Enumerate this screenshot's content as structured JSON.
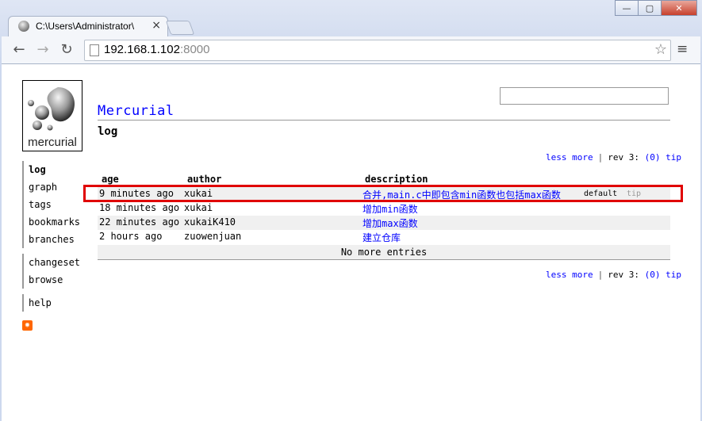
{
  "browser": {
    "tab_title": "C:\\Users\\Administrator\\",
    "tab_close": "×",
    "url_host": "192.168.1.102",
    "url_port": ":8000",
    "back": "←",
    "forward": "→",
    "reload": "↻",
    "star": "☆",
    "menu": "≡",
    "minimize": "—",
    "maximize": "▢",
    "close": "✕"
  },
  "header": {
    "logo_text": "mercurial",
    "title": "Mercurial",
    "subtitle": "log"
  },
  "sidebar": {
    "group1": [
      "log",
      "graph",
      "tags",
      "bookmarks",
      "branches"
    ],
    "group2": [
      "changeset",
      "browse"
    ],
    "group3": [
      "help"
    ],
    "rss": "rss"
  },
  "navigation": {
    "less": "less",
    "more": "more",
    "sep": "|",
    "rev": "rev 3:",
    "zero": "(0)",
    "tip": "tip"
  },
  "table": {
    "columns": [
      "age",
      "author",
      "description"
    ],
    "rows": [
      {
        "age": "9 minutes ago",
        "author": "xukai",
        "description": "合并,main.c中即包含min函数也包括max函数",
        "tag": "default",
        "tip": "tip"
      },
      {
        "age": "18 minutes ago",
        "author": "xukai",
        "description": "增加min函数"
      },
      {
        "age": "22 minutes ago",
        "author": "xukaiK410",
        "description": "增加max函数"
      },
      {
        "age": "2 hours ago",
        "author": "zuowenjuan",
        "description": "建立仓库"
      }
    ],
    "footer": "No more entries"
  },
  "colors": {
    "link": "#0000ff",
    "highlight": "#e00000",
    "row_alt": "#f0f0f0"
  }
}
